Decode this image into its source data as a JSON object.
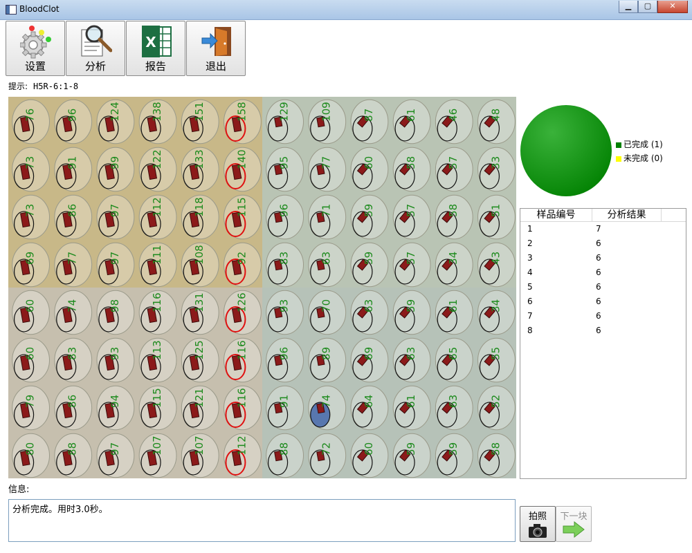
{
  "window": {
    "title": "BloodClot",
    "minimize": "▁",
    "maximize": "▢",
    "close": "✕"
  },
  "toolbar": [
    {
      "key": "settings",
      "label": "设置",
      "icon": "gear-icon"
    },
    {
      "key": "analyze",
      "label": "分析",
      "icon": "magnifier-icon"
    },
    {
      "key": "report",
      "label": "报告",
      "icon": "excel-icon"
    },
    {
      "key": "exit",
      "label": "退出",
      "icon": "exit-door-icon"
    }
  ],
  "hint": {
    "label": "提示:",
    "value": "H5R-6:1-8"
  },
  "plate": {
    "quadrant_colors": [
      "#c8b888",
      "#b9c4b4",
      "#b6c2b8",
      "#c6bfae"
    ],
    "left_values": [
      [
        76,
        96,
        124,
        138,
        151,
        158
      ],
      [
        73,
        91,
        99,
        122,
        133,
        140
      ],
      [
        73,
        86,
        97,
        112,
        118,
        115
      ],
      [
        69,
        77,
        97,
        111,
        108,
        92
      ],
      [
        60,
        74,
        98,
        116,
        131,
        126
      ],
      [
        60,
        83,
        93,
        113,
        125,
        116
      ],
      [
        79,
        86,
        94,
        115,
        121,
        116
      ],
      [
        80,
        88,
        97,
        107,
        107,
        112
      ]
    ],
    "right_values": [
      [
        129,
        109,
        87,
        61,
        46,
        48
      ],
      [
        95,
        77,
        60,
        58,
        57,
        33
      ],
      [
        96,
        71,
        59,
        57,
        58,
        51
      ],
      [
        83,
        63,
        59,
        57,
        34,
        43
      ],
      [
        93,
        70,
        63,
        59,
        61,
        34
      ],
      [
        96,
        89,
        69,
        63,
        65,
        55
      ],
      [
        91,
        74,
        64,
        61,
        63,
        52
      ],
      [
        88,
        72,
        60,
        59,
        59,
        58
      ]
    ]
  },
  "legend": [
    {
      "label": "已完成 (1)",
      "color": "#008000"
    },
    {
      "label": "未完成 (0)",
      "color": "#ffff00"
    }
  ],
  "chart_data": {
    "type": "pie",
    "categories": [
      "已完成",
      "未完成"
    ],
    "values": [
      1,
      0
    ],
    "colors": [
      "#008000",
      "#ffff00"
    ]
  },
  "results": {
    "headers": [
      "样品编号",
      "分析结果"
    ],
    "rows": [
      [
        "1",
        "7"
      ],
      [
        "2",
        "6"
      ],
      [
        "3",
        "6"
      ],
      [
        "4",
        "6"
      ],
      [
        "5",
        "6"
      ],
      [
        "6",
        "6"
      ],
      [
        "7",
        "6"
      ],
      [
        "8",
        "6"
      ]
    ]
  },
  "info": {
    "label": "信息:",
    "text": "分析完成。用时3.0秒。"
  },
  "buttons": {
    "photo": "拍照",
    "next": "下一块"
  }
}
